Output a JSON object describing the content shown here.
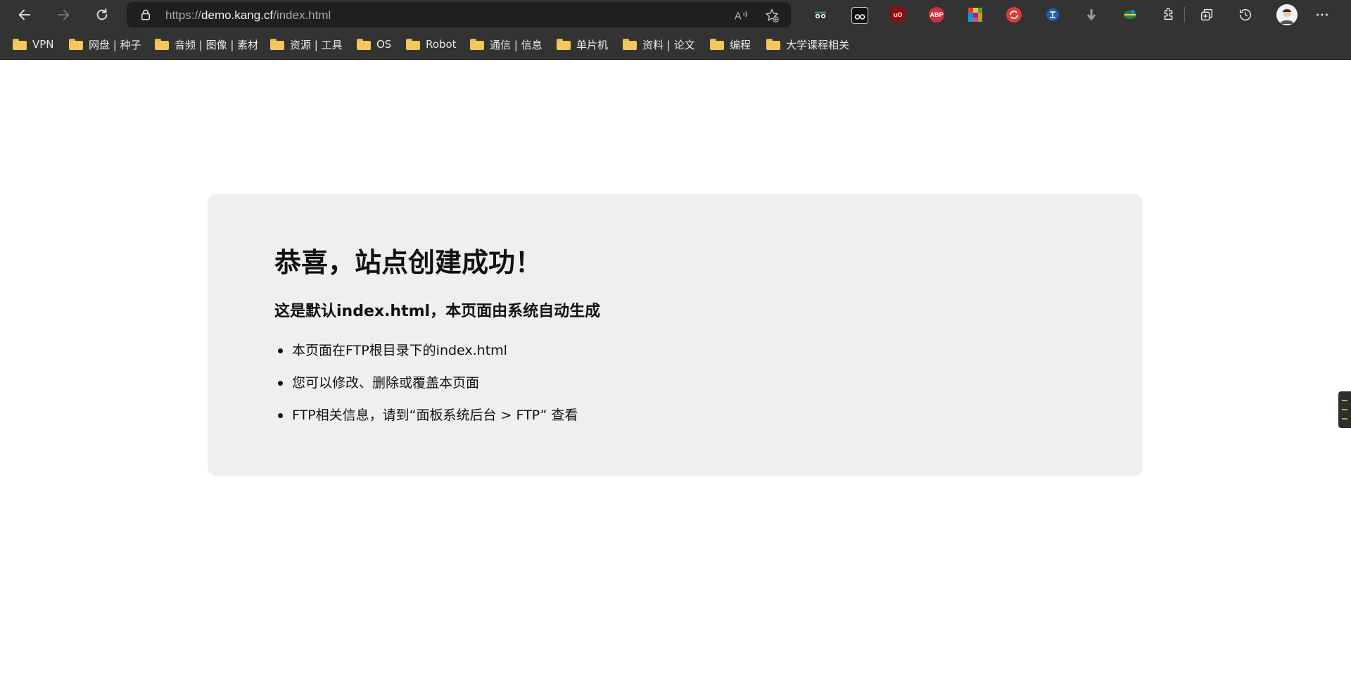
{
  "browser": {
    "url_scheme": "https://",
    "url_host": "demo.kang.cf",
    "url_path": "/index.html"
  },
  "extensions": [
    {
      "name": "spy-glasses-extension-icon"
    },
    {
      "name": "tampermonkey-icon"
    },
    {
      "name": "ublock-origin-icon",
      "label": "uO"
    },
    {
      "name": "adblock-plus-icon",
      "label": "ABP"
    },
    {
      "name": "color-palette-extension-icon"
    },
    {
      "name": "sync-extension-icon"
    },
    {
      "name": "translate-extension-icon"
    },
    {
      "name": "download-extension-icon"
    },
    {
      "name": "earth-extension-icon"
    }
  ],
  "bookmarks": [
    "VPN",
    "网盘 | 种子",
    "音频 | 图像 | 素材",
    "资源 | 工具",
    "OS",
    "Robot",
    "通信 | 信息",
    "单片机",
    "资料 | 论文",
    "编程",
    "大学课程相关"
  ],
  "page": {
    "title": "恭喜，站点创建成功！",
    "subtitle": "这是默认index.html，本页面由系统自动生成",
    "items": [
      "本页面在FTP根目录下的index.html",
      "您可以修改、删除或覆盖本页面",
      "FTP相关信息，请到“面板系统后台 > FTP” 查看"
    ]
  },
  "colors": {
    "chrome_bg": "#333333",
    "omnibox_bg": "#1f1f1f",
    "card_bg": "#efefef",
    "folder": "#f5c75a"
  }
}
